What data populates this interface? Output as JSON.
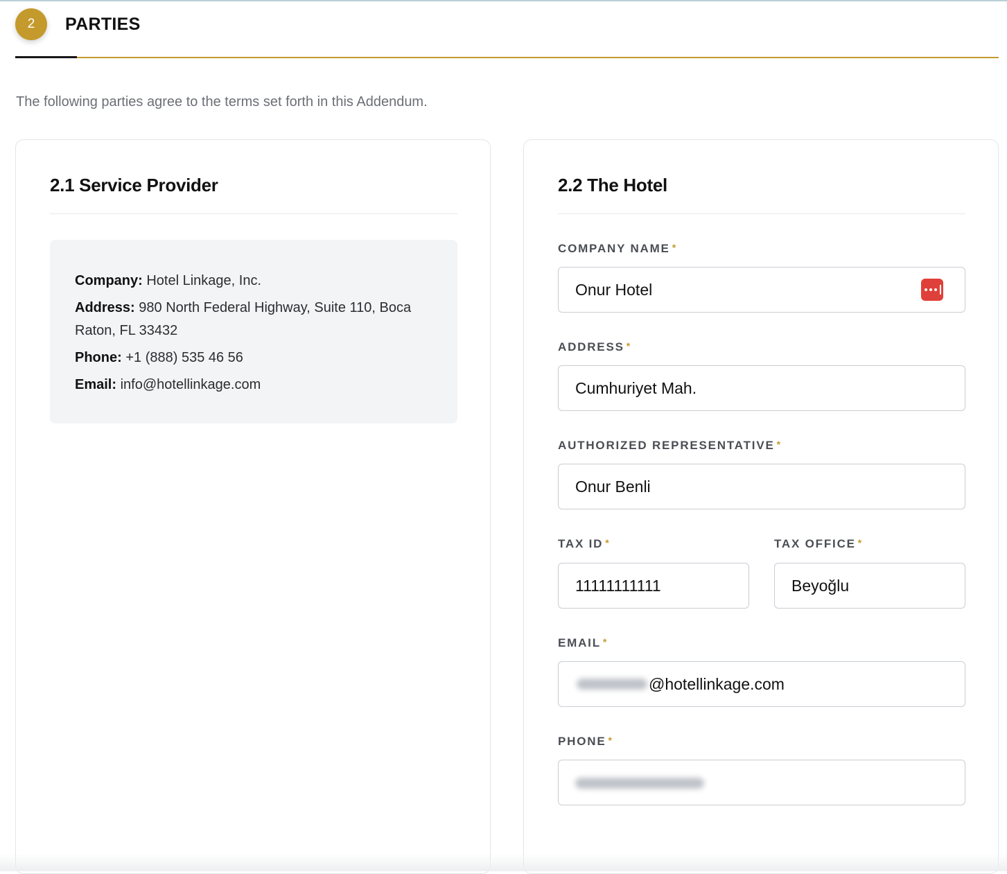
{
  "section": {
    "step_number": "2",
    "title": "PARTIES",
    "intro": "The following parties agree to the terms set forth in this Addendum."
  },
  "provider_card": {
    "title": "2.1 Service Provider",
    "company_label": "Company:",
    "company_value": "Hotel Linkage, Inc.",
    "address_label": "Address:",
    "address_value": "980 North Federal Highway, Suite 110, Boca Raton, FL 33432",
    "phone_label": "Phone:",
    "phone_value": "+1 (888) 535 46 56",
    "email_label": "Email:",
    "email_value": "info@hotellinkage.com"
  },
  "hotel_card": {
    "title": "2.2 The Hotel",
    "required_marker": "*",
    "fields": {
      "company_name": {
        "label": "COMPANY NAME",
        "value": "Onur Hotel"
      },
      "address": {
        "label": "ADDRESS",
        "value": "Cumhuriyet Mah."
      },
      "authorized_representative": {
        "label": "AUTHORIZED REPRESENTATIVE",
        "value": "Onur Benli"
      },
      "tax_id": {
        "label": "TAX ID",
        "value": "11111111111"
      },
      "tax_office": {
        "label": "TAX OFFICE",
        "value": "Beyoğlu"
      },
      "email": {
        "label": "EMAIL",
        "value_visible_suffix": "@hotellinkage.com"
      },
      "phone": {
        "label": "PHONE"
      }
    },
    "company_name_icon": "password-manager-icon"
  },
  "colors": {
    "accent_gold": "#c49a2c",
    "password_icon_red": "#e0403a"
  }
}
